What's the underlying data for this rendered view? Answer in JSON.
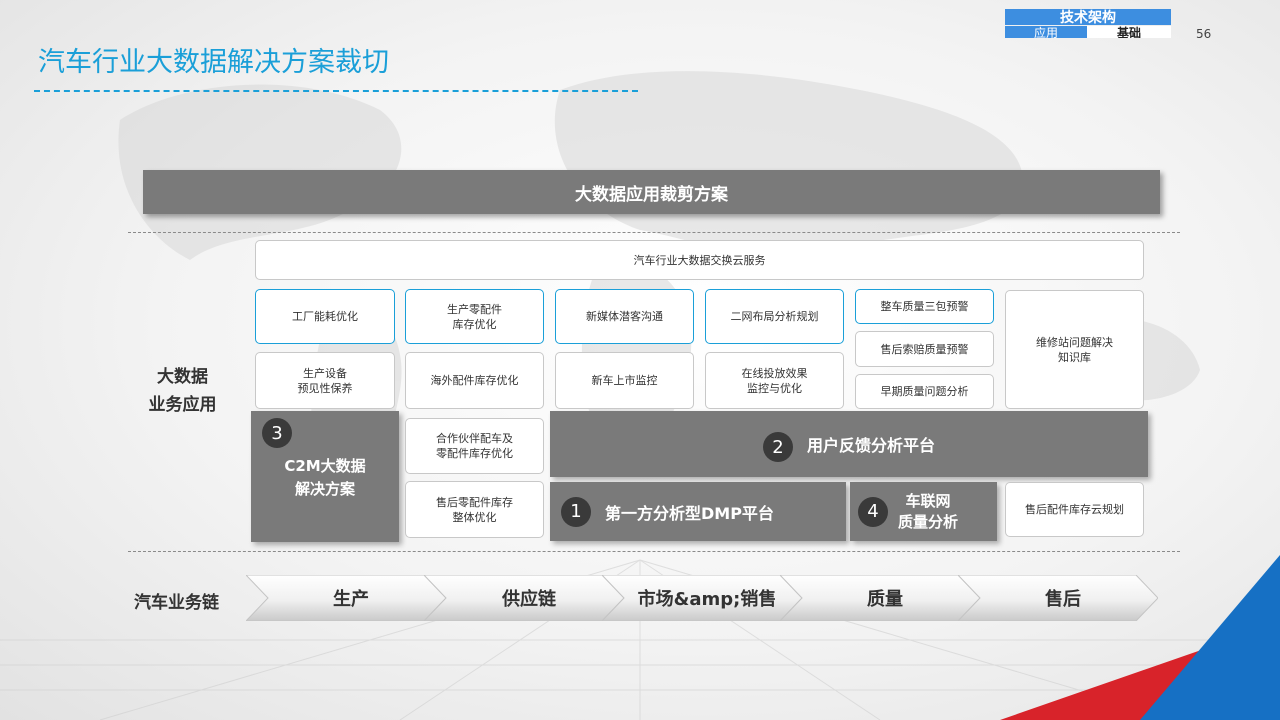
{
  "header": {
    "title": "汽车行业大数据解决方案裁切",
    "page_number": "56",
    "tag_top": "技术架构",
    "tag_bottom": [
      "应用",
      "基础"
    ]
  },
  "banner": "大数据应用裁剪方案",
  "cloud_service": "汽车行业大数据交换云服务",
  "side_label": [
    "大数据",
    "业务应用"
  ],
  "cards": {
    "factory_energy": "工厂能耗优化",
    "parts_inventory": "生产零配件\n库存优化",
    "new_media": "新媒体潜客沟通",
    "network_layout": "二网布局分析规划",
    "warranty_warning": "整车质量三包预警",
    "claims_warning": "售后索赔质量预警",
    "early_quality": "早期质量问题分析",
    "repair_kb": "维修站问题解决\n知识库",
    "equipment_maint": "生产设备\n预见性保养",
    "overseas_parts": "海外配件库存优化",
    "new_car_monitor": "新车上市监控",
    "ad_monitor": "在线投放效果\n监控与优化",
    "partner_parts": "合作伙伴配车及\n零配件库存优化",
    "aftersale_parts": "售后零配件库存\n整体优化",
    "aftersale_cloud": "售后配件库存云规划"
  },
  "platforms": {
    "c2m": {
      "num": "3",
      "label": "C2M大数据\n解决方案"
    },
    "feedback": {
      "num": "2",
      "label": "用户反馈分析平台"
    },
    "dmp": {
      "num": "1",
      "label": "第一方分析型DMP平台"
    },
    "iov": {
      "num": "4",
      "label": "车联网\n质量分析"
    }
  },
  "chain": {
    "label": "汽车业务链",
    "steps": [
      "生产",
      "供应链",
      "市场&amp;销售",
      "质量",
      "售后"
    ]
  },
  "colors": {
    "accent": "#1a9fd8",
    "panel_gray": "#7a7a7a",
    "corner_red": "#d8232a",
    "corner_blue": "#1670c4"
  }
}
